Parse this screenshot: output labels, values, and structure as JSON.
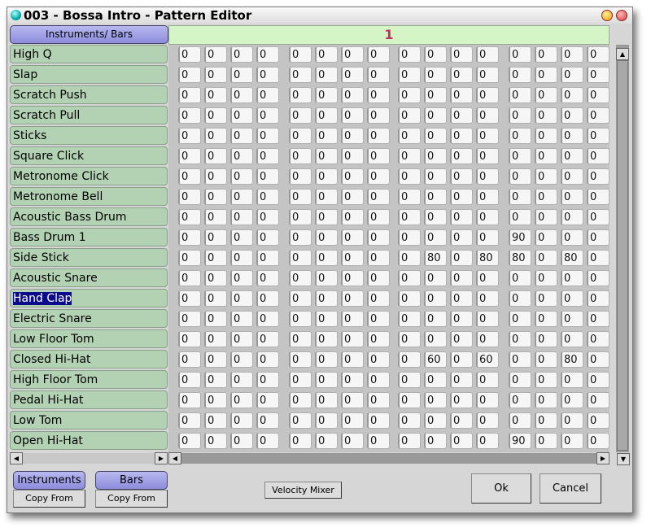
{
  "window": {
    "title": "003 - Bossa Intro - Pattern Editor"
  },
  "header": {
    "corner_label": "Instruments/ Bars",
    "bar_number": "1"
  },
  "instruments": [
    {
      "name": "High Q",
      "values": [
        0,
        0,
        0,
        0,
        0,
        0,
        0,
        0,
        0,
        0,
        0,
        0,
        0,
        0,
        0,
        0
      ]
    },
    {
      "name": "Slap",
      "values": [
        0,
        0,
        0,
        0,
        0,
        0,
        0,
        0,
        0,
        0,
        0,
        0,
        0,
        0,
        0,
        0
      ]
    },
    {
      "name": "Scratch Push",
      "values": [
        0,
        0,
        0,
        0,
        0,
        0,
        0,
        0,
        0,
        0,
        0,
        0,
        0,
        0,
        0,
        0
      ]
    },
    {
      "name": "Scratch Pull",
      "values": [
        0,
        0,
        0,
        0,
        0,
        0,
        0,
        0,
        0,
        0,
        0,
        0,
        0,
        0,
        0,
        0
      ]
    },
    {
      "name": "Sticks",
      "values": [
        0,
        0,
        0,
        0,
        0,
        0,
        0,
        0,
        0,
        0,
        0,
        0,
        0,
        0,
        0,
        0
      ]
    },
    {
      "name": "Square Click",
      "values": [
        0,
        0,
        0,
        0,
        0,
        0,
        0,
        0,
        0,
        0,
        0,
        0,
        0,
        0,
        0,
        0
      ]
    },
    {
      "name": "Metronome Click",
      "values": [
        0,
        0,
        0,
        0,
        0,
        0,
        0,
        0,
        0,
        0,
        0,
        0,
        0,
        0,
        0,
        0
      ]
    },
    {
      "name": "Metronome Bell",
      "values": [
        0,
        0,
        0,
        0,
        0,
        0,
        0,
        0,
        0,
        0,
        0,
        0,
        0,
        0,
        0,
        0
      ]
    },
    {
      "name": "Acoustic Bass Drum",
      "values": [
        0,
        0,
        0,
        0,
        0,
        0,
        0,
        0,
        0,
        0,
        0,
        0,
        0,
        0,
        0,
        0
      ]
    },
    {
      "name": "Bass Drum 1",
      "values": [
        0,
        0,
        0,
        0,
        0,
        0,
        0,
        0,
        0,
        0,
        0,
        0,
        90,
        0,
        0,
        0
      ]
    },
    {
      "name": "Side Stick",
      "values": [
        0,
        0,
        0,
        0,
        0,
        0,
        0,
        0,
        0,
        80,
        0,
        80,
        80,
        0,
        80,
        0
      ]
    },
    {
      "name": "Acoustic Snare",
      "values": [
        0,
        0,
        0,
        0,
        0,
        0,
        0,
        0,
        0,
        0,
        0,
        0,
        0,
        0,
        0,
        0
      ]
    },
    {
      "name": "Hand Clap",
      "selected": true,
      "values": [
        0,
        0,
        0,
        0,
        0,
        0,
        0,
        0,
        0,
        0,
        0,
        0,
        0,
        0,
        0,
        0
      ]
    },
    {
      "name": "Electric Snare",
      "values": [
        0,
        0,
        0,
        0,
        0,
        0,
        0,
        0,
        0,
        0,
        0,
        0,
        0,
        0,
        0,
        0
      ]
    },
    {
      "name": "Low Floor Tom",
      "values": [
        0,
        0,
        0,
        0,
        0,
        0,
        0,
        0,
        0,
        0,
        0,
        0,
        0,
        0,
        0,
        0
      ]
    },
    {
      "name": "Closed Hi-Hat",
      "values": [
        0,
        0,
        0,
        0,
        0,
        0,
        0,
        0,
        0,
        60,
        0,
        60,
        0,
        0,
        80,
        0
      ]
    },
    {
      "name": "High Floor Tom",
      "values": [
        0,
        0,
        0,
        0,
        0,
        0,
        0,
        0,
        0,
        0,
        0,
        0,
        0,
        0,
        0,
        0
      ]
    },
    {
      "name": "Pedal Hi-Hat",
      "values": [
        0,
        0,
        0,
        0,
        0,
        0,
        0,
        0,
        0,
        0,
        0,
        0,
        0,
        0,
        0,
        0
      ]
    },
    {
      "name": "Low Tom",
      "values": [
        0,
        0,
        0,
        0,
        0,
        0,
        0,
        0,
        0,
        0,
        0,
        0,
        0,
        0,
        0,
        0
      ]
    },
    {
      "name": "Open Hi-Hat",
      "values": [
        0,
        0,
        0,
        0,
        0,
        0,
        0,
        0,
        0,
        0,
        0,
        0,
        90,
        0,
        0,
        0
      ]
    }
  ],
  "bottom": {
    "instruments_label": "Instruments",
    "bars_label": "Bars",
    "copy_from_label": "Copy From",
    "velocity_mixer": "Velocity Mixer",
    "ok": "Ok",
    "cancel": "Cancel"
  }
}
